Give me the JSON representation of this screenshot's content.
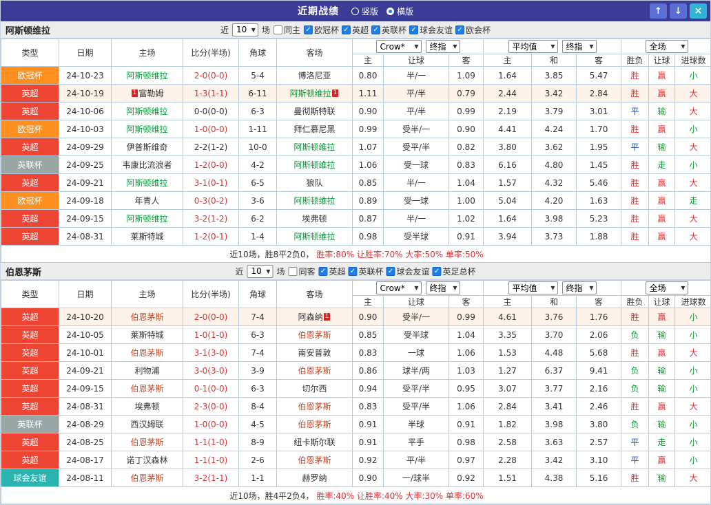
{
  "titlebar": {
    "title": "近期战绩",
    "radios": [
      {
        "label": "竖版",
        "selected": false
      },
      {
        "label": "横版",
        "selected": true
      }
    ],
    "buttons": {
      "up": "↑",
      "down": "↓",
      "close": "×"
    }
  },
  "filter_labels": {
    "near": "近",
    "games": "场"
  },
  "selects": {
    "company": "Crow*",
    "final": "终指",
    "average": "平均值",
    "final2": "终指",
    "scope": "全场"
  },
  "columns": {
    "type": "类型",
    "date": "日期",
    "home": "主场",
    "score": "比分(半场)",
    "corner": "角球",
    "away": "客场",
    "host": "主",
    "handicap": "让球",
    "guest": "客",
    "avg_host": "主",
    "avg_draw": "和",
    "avg_guest": "客",
    "wdl": "胜负",
    "let_result": "让球",
    "goals": "进球数"
  },
  "type_colors": {
    "欧冠杯": "#ff8f1f",
    "英超": "#ee4433",
    "英联杯": "#98a6a6",
    "球会友谊": "#2cb4b0"
  },
  "result_colors": {
    "胜": "#e03030",
    "平": "#1b50c8",
    "负": "#0a9a2a",
    "赢": "#e03030",
    "输": "#0a9a2a",
    "走": "#0a9a2a",
    "大": "#e03030",
    "小": "#0a9a2a"
  },
  "colors": {
    "score_red": "#e03030",
    "score_dark": "#333333",
    "accent_bar": "#3a3c96"
  },
  "sections": [
    {
      "team": "阿斯顿维拉",
      "team_color": "#0a9a3c",
      "filter": {
        "count": "10",
        "same_label": "同主",
        "same_checked": false,
        "leagues": [
          {
            "label": "欧冠杯",
            "checked": true
          },
          {
            "label": "英超",
            "checked": true
          },
          {
            "label": "英联杯",
            "checked": true
          },
          {
            "label": "球会友谊",
            "checked": true
          },
          {
            "label": "欧会杯",
            "checked": true
          }
        ]
      },
      "rows": [
        {
          "type": "欧冠杯",
          "date": "24-10-23",
          "home": {
            "name": "阿斯顿维拉",
            "focus": true
          },
          "away": {
            "name": "博洛尼亚"
          },
          "score": "2-0(0-0)",
          "score_red": true,
          "corner": "5-4",
          "odds": [
            "0.80",
            "半/一",
            "1.09"
          ],
          "avg": [
            "1.64",
            "3.85",
            "5.47"
          ],
          "results": [
            "胜",
            "赢",
            "小"
          ]
        },
        {
          "type": "英超",
          "date": "24-10-19",
          "home": {
            "name": "富勒姆",
            "badge_before": "1"
          },
          "away": {
            "name": "阿斯顿维拉",
            "focus": true,
            "badge_after": "1"
          },
          "score": "1-3(1-1)",
          "score_red": true,
          "corner": "6-11",
          "odds": [
            "1.11",
            "平/半",
            "0.79"
          ],
          "avg": [
            "2.44",
            "3.42",
            "2.84"
          ],
          "results": [
            "胜",
            "赢",
            "大"
          ],
          "highlight": true
        },
        {
          "type": "英超",
          "date": "24-10-06",
          "home": {
            "name": "阿斯顿维拉",
            "focus": true
          },
          "away": {
            "name": "曼彻斯特联"
          },
          "score": "0-0(0-0)",
          "score_red": false,
          "corner": "6-3",
          "odds": [
            "0.90",
            "平/半",
            "0.99"
          ],
          "avg": [
            "2.19",
            "3.79",
            "3.01"
          ],
          "results": [
            "平",
            "输",
            "大"
          ]
        },
        {
          "type": "欧冠杯",
          "date": "24-10-03",
          "home": {
            "name": "阿斯顿维拉",
            "focus": true
          },
          "away": {
            "name": "拜仁慕尼黑"
          },
          "score": "1-0(0-0)",
          "score_red": true,
          "corner": "1-11",
          "odds": [
            "0.99",
            "受半/一",
            "0.90"
          ],
          "avg": [
            "4.41",
            "4.24",
            "1.70"
          ],
          "results": [
            "胜",
            "赢",
            "小"
          ]
        },
        {
          "type": "英超",
          "date": "24-09-29",
          "home": {
            "name": "伊普斯维奇"
          },
          "away": {
            "name": "阿斯顿维拉",
            "focus": true
          },
          "score": "2-2(1-2)",
          "score_red": false,
          "corner": "10-0",
          "odds": [
            "1.07",
            "受平/半",
            "0.82"
          ],
          "avg": [
            "3.80",
            "3.62",
            "1.95"
          ],
          "results": [
            "平",
            "输",
            "大"
          ]
        },
        {
          "type": "英联杯",
          "date": "24-09-25",
          "home": {
            "name": "韦康比流浪者"
          },
          "away": {
            "name": "阿斯顿维拉",
            "focus": true
          },
          "score": "1-2(0-0)",
          "score_red": true,
          "corner": "4-2",
          "odds": [
            "1.06",
            "受一球",
            "0.83"
          ],
          "avg": [
            "6.16",
            "4.80",
            "1.45"
          ],
          "results": [
            "胜",
            "走",
            "小"
          ]
        },
        {
          "type": "英超",
          "date": "24-09-21",
          "home": {
            "name": "阿斯顿维拉",
            "focus": true
          },
          "away": {
            "name": "狼队"
          },
          "score": "3-1(0-1)",
          "score_red": true,
          "corner": "6-5",
          "odds": [
            "0.85",
            "半/一",
            "1.04"
          ],
          "avg": [
            "1.57",
            "4.32",
            "5.46"
          ],
          "results": [
            "胜",
            "赢",
            "大"
          ]
        },
        {
          "type": "欧冠杯",
          "date": "24-09-18",
          "home": {
            "name": "年青人"
          },
          "away": {
            "name": "阿斯顿维拉",
            "focus": true
          },
          "score": "0-3(0-2)",
          "score_red": true,
          "corner": "3-6",
          "odds": [
            "0.89",
            "受一球",
            "1.00"
          ],
          "avg": [
            "5.04",
            "4.20",
            "1.63"
          ],
          "results": [
            "胜",
            "赢",
            "走"
          ]
        },
        {
          "type": "英超",
          "date": "24-09-15",
          "home": {
            "name": "阿斯顿维拉",
            "focus": true
          },
          "away": {
            "name": "埃弗顿"
          },
          "score": "3-2(1-2)",
          "score_red": true,
          "corner": "6-2",
          "odds": [
            "0.87",
            "半/一",
            "1.02"
          ],
          "avg": [
            "1.64",
            "3.98",
            "5.23"
          ],
          "results": [
            "胜",
            "赢",
            "大"
          ]
        },
        {
          "type": "英超",
          "date": "24-08-31",
          "home": {
            "name": "莱斯特城"
          },
          "away": {
            "name": "阿斯顿维拉",
            "focus": true
          },
          "score": "1-2(0-1)",
          "score_red": true,
          "corner": "1-4",
          "odds": [
            "0.98",
            "受半球",
            "0.91"
          ],
          "avg": [
            "3.94",
            "3.73",
            "1.88"
          ],
          "results": [
            "胜",
            "赢",
            "大"
          ]
        }
      ],
      "summary": {
        "prefix": "近10场，胜8平2负0，",
        "stats": "胜率:80% 让胜率:70% 大率:50% 单率:50%"
      }
    },
    {
      "team": "伯恩茅斯",
      "team_color": "#cc4a22",
      "filter": {
        "count": "10",
        "same_label": "同客",
        "same_checked": false,
        "leagues": [
          {
            "label": "英超",
            "checked": true
          },
          {
            "label": "英联杯",
            "checked": true
          },
          {
            "label": "球会友谊",
            "checked": true
          },
          {
            "label": "英足总杯",
            "checked": true
          }
        ]
      },
      "rows": [
        {
          "type": "英超",
          "date": "24-10-20",
          "home": {
            "name": "伯恩茅斯",
            "focus": true
          },
          "away": {
            "name": "阿森纳",
            "badge_after": "1"
          },
          "score": "2-0(0-0)",
          "score_red": true,
          "corner": "7-4",
          "odds": [
            "0.90",
            "受半/一",
            "0.99"
          ],
          "avg": [
            "4.61",
            "3.76",
            "1.76"
          ],
          "results": [
            "胜",
            "赢",
            "小"
          ],
          "highlight": true
        },
        {
          "type": "英超",
          "date": "24-10-05",
          "home": {
            "name": "莱斯特城"
          },
          "away": {
            "name": "伯恩茅斯",
            "focus": true
          },
          "score": "1-0(1-0)",
          "score_red": true,
          "corner": "6-3",
          "odds": [
            "0.85",
            "受半球",
            "1.04"
          ],
          "avg": [
            "3.35",
            "3.70",
            "2.06"
          ],
          "results": [
            "负",
            "输",
            "小"
          ]
        },
        {
          "type": "英超",
          "date": "24-10-01",
          "home": {
            "name": "伯恩茅斯",
            "focus": true
          },
          "away": {
            "name": "南安普敦"
          },
          "score": "3-1(3-0)",
          "score_red": true,
          "corner": "7-4",
          "odds": [
            "0.83",
            "一球",
            "1.06"
          ],
          "avg": [
            "1.53",
            "4.48",
            "5.68"
          ],
          "results": [
            "胜",
            "赢",
            "大"
          ]
        },
        {
          "type": "英超",
          "date": "24-09-21",
          "home": {
            "name": "利物浦"
          },
          "away": {
            "name": "伯恩茅斯",
            "focus": true
          },
          "score": "3-0(3-0)",
          "score_red": true,
          "corner": "3-9",
          "odds": [
            "0.86",
            "球半/两",
            "1.03"
          ],
          "avg": [
            "1.27",
            "6.37",
            "9.41"
          ],
          "results": [
            "负",
            "输",
            "小"
          ]
        },
        {
          "type": "英超",
          "date": "24-09-15",
          "home": {
            "name": "伯恩茅斯",
            "focus": true
          },
          "away": {
            "name": "切尔西"
          },
          "score": "0-1(0-0)",
          "score_red": true,
          "corner": "6-3",
          "odds": [
            "0.94",
            "受平/半",
            "0.95"
          ],
          "avg": [
            "3.07",
            "3.77",
            "2.16"
          ],
          "results": [
            "负",
            "输",
            "小"
          ]
        },
        {
          "type": "英超",
          "date": "24-08-31",
          "home": {
            "name": "埃弗顿"
          },
          "away": {
            "name": "伯恩茅斯",
            "focus": true
          },
          "score": "2-3(0-0)",
          "score_red": true,
          "corner": "8-4",
          "odds": [
            "0.83",
            "受平/半",
            "1.06"
          ],
          "avg": [
            "2.84",
            "3.41",
            "2.46"
          ],
          "results": [
            "胜",
            "赢",
            "大"
          ]
        },
        {
          "type": "英联杯",
          "date": "24-08-29",
          "home": {
            "name": "西汉姆联"
          },
          "away": {
            "name": "伯恩茅斯",
            "focus": true
          },
          "score": "1-0(0-0)",
          "score_red": true,
          "corner": "4-5",
          "odds": [
            "0.91",
            "半球",
            "0.91"
          ],
          "avg": [
            "1.82",
            "3.98",
            "3.80"
          ],
          "results": [
            "负",
            "输",
            "小"
          ]
        },
        {
          "type": "英超",
          "date": "24-08-25",
          "home": {
            "name": "伯恩茅斯",
            "focus": true
          },
          "away": {
            "name": "纽卡斯尔联"
          },
          "score": "1-1(1-0)",
          "score_red": true,
          "corner": "8-9",
          "odds": [
            "0.91",
            "平手",
            "0.98"
          ],
          "avg": [
            "2.58",
            "3.63",
            "2.57"
          ],
          "results": [
            "平",
            "走",
            "小"
          ]
        },
        {
          "type": "英超",
          "date": "24-08-17",
          "home": {
            "name": "诺丁汉森林"
          },
          "away": {
            "name": "伯恩茅斯",
            "focus": true
          },
          "score": "1-1(1-0)",
          "score_red": true,
          "corner": "2-6",
          "odds": [
            "0.92",
            "平/半",
            "0.97"
          ],
          "avg": [
            "2.28",
            "3.42",
            "3.10"
          ],
          "results": [
            "平",
            "赢",
            "小"
          ]
        },
        {
          "type": "球会友谊",
          "date": "24-08-11",
          "home": {
            "name": "伯恩茅斯",
            "focus": true
          },
          "away": {
            "name": "赫罗纳"
          },
          "score": "3-2(1-1)",
          "score_red": true,
          "corner": "1-1",
          "odds": [
            "0.90",
            "一/球半",
            "0.92"
          ],
          "avg": [
            "1.51",
            "4.38",
            "5.16"
          ],
          "results": [
            "胜",
            "输",
            "大"
          ]
        }
      ],
      "summary": {
        "prefix": "近10场，胜4平2负4，",
        "stats": "胜率:40% 让胜率:40% 大率:30% 单率:60%"
      }
    }
  ]
}
